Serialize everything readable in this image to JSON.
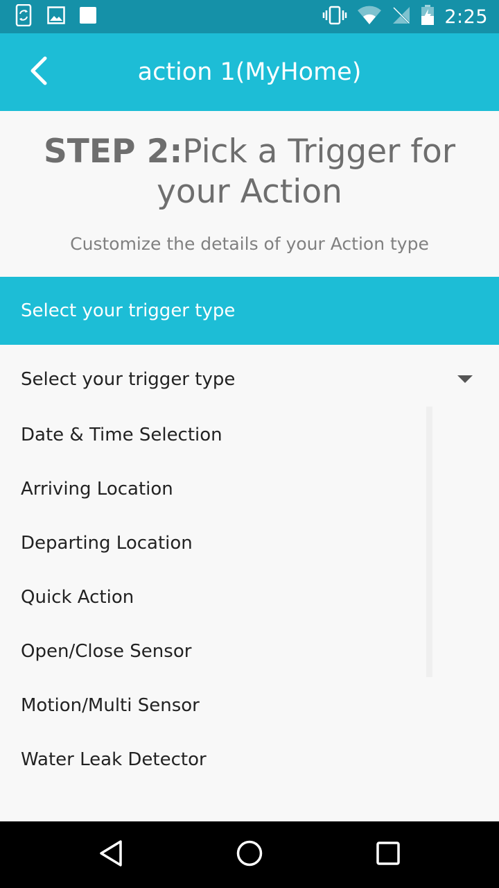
{
  "status_bar": {
    "time": "2:25",
    "left_icons": [
      "phone-sync-icon",
      "image-icon",
      "square-notification-icon"
    ],
    "right_icons": [
      "vibrate-icon",
      "wifi-icon",
      "no-signal-icon",
      "battery-charging-icon"
    ]
  },
  "app_bar": {
    "title": "action 1(MyHome)",
    "back_icon": "chevron-left-icon"
  },
  "step": {
    "prefix": "STEP 2:",
    "title": "Pick a Trigger for your Action",
    "subtitle": "Customize the details of your Action type"
  },
  "trigger_section": {
    "header": "Select your trigger type",
    "dropdown_label": "Select your trigger type",
    "options": [
      "Date & Time Selection",
      "Arriving Location",
      "Departing Location",
      "Quick Action",
      "Open/Close Sensor",
      "Motion/Multi Sensor",
      "Water Leak Detector"
    ]
  },
  "nav_bar": {
    "buttons": [
      "back-triangle-icon",
      "home-circle-icon",
      "recents-square-icon"
    ]
  },
  "colors": {
    "status_bar": "#1591a8",
    "accent": "#1dbdd6",
    "background": "#f8f8f8",
    "nav_bar": "#000000"
  }
}
